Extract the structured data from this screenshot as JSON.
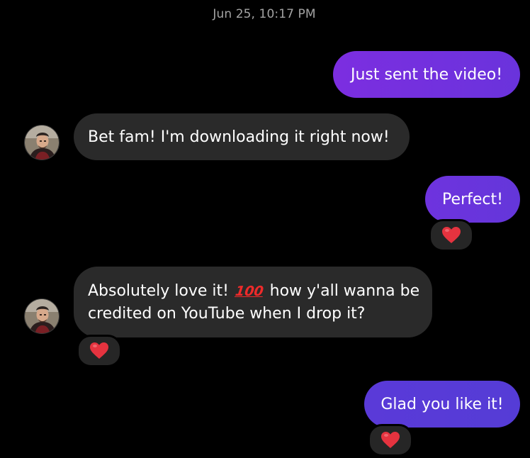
{
  "timestamp": "Jun 25, 10:17 PM",
  "colors": {
    "background": "#000000",
    "received_bubble": "#2a2a2a",
    "sent_gradient_start": "#7a2fe0",
    "sent_gradient_end": "#5b3ad8",
    "reaction_bubble": "#262626",
    "heart": "#e5333f",
    "timestamp_text": "#a3a3a3"
  },
  "messages": [
    {
      "direction": "sent",
      "text": "Just sent the video!"
    },
    {
      "direction": "received",
      "text": "Bet fam! I'm downloading it right now!",
      "avatar": "contact-avatar"
    },
    {
      "direction": "sent",
      "text": "Perfect!",
      "reaction": "heart-icon"
    },
    {
      "direction": "received",
      "text_part1": "Absolutely love it!",
      "emoji": "100",
      "text_part2": "how y'all wanna be",
      "text_line2": "credited on YouTube when I drop it?",
      "avatar": "contact-avatar",
      "reaction": "heart-icon"
    },
    {
      "direction": "sent",
      "text": "Glad you like it!",
      "reaction": "heart-icon"
    }
  ]
}
